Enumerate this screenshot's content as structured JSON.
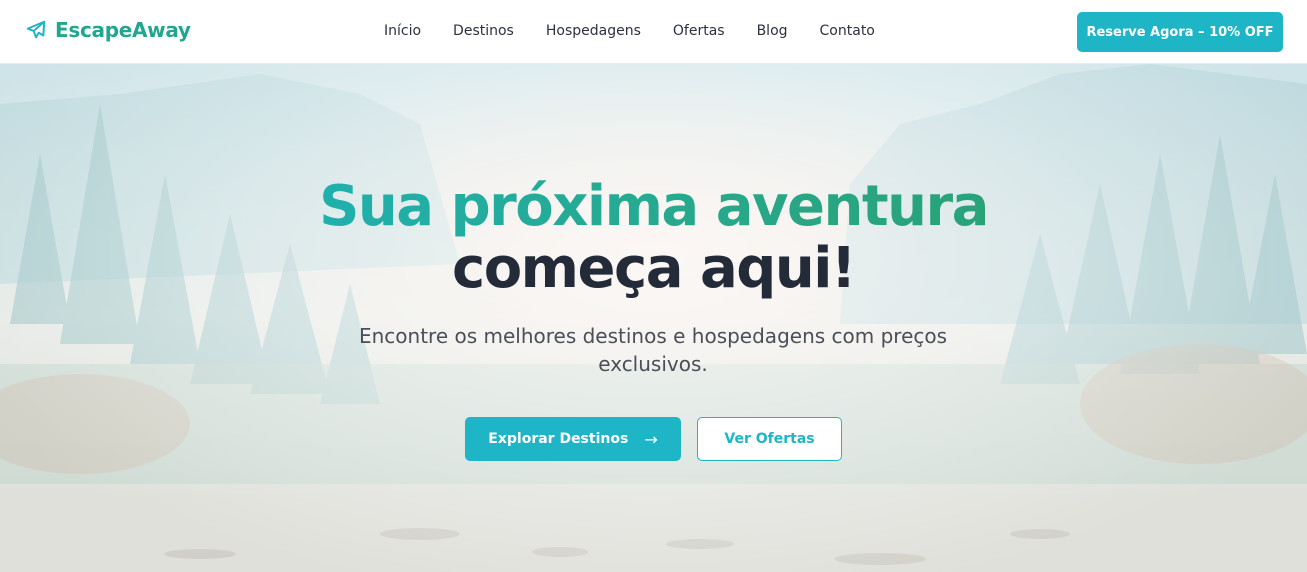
{
  "brand": {
    "name": "EscapeAway",
    "icon": "plane-icon",
    "color": "#23a58f"
  },
  "nav": {
    "items": [
      {
        "label": "Início"
      },
      {
        "label": "Destinos"
      },
      {
        "label": "Hospedagens"
      },
      {
        "label": "Ofertas"
      },
      {
        "label": "Blog"
      },
      {
        "label": "Contato"
      }
    ],
    "cta_label": "Reserve Agora – 10% OFF"
  },
  "hero": {
    "headline_line1": "Sua próxima aventura",
    "headline_line2": "começa aqui!",
    "subtitle": "Encontre os melhores destinos e hospedagens com preços exclusivos.",
    "primary_button": "Explorar Destinos",
    "primary_icon": "arrow-right-icon",
    "secondary_button": "Ver Ofertas",
    "background": "misty-forest-mountains-image"
  },
  "colors": {
    "accent": "#1eb6c7",
    "accent_green": "#2b9c62",
    "text_dark": "#232a38"
  }
}
